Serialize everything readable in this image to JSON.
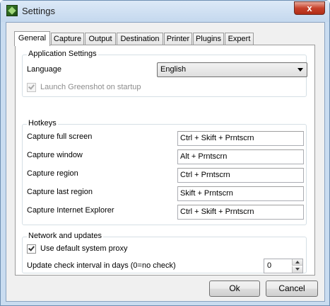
{
  "window": {
    "title": "Settings",
    "close_glyph": "x"
  },
  "tabs": [
    "General",
    "Capture",
    "Output",
    "Destination",
    "Printer",
    "Plugins",
    "Expert"
  ],
  "app_settings": {
    "title": "Application Settings",
    "language_label": "Language",
    "language_value": "English",
    "launch_label": "Launch Greenshot on startup",
    "launch_checked": true,
    "launch_enabled": false
  },
  "hotkeys": {
    "title": "Hotkeys",
    "items": [
      {
        "label": "Capture full screen",
        "value": "Ctrl + Skift + Prntscrn"
      },
      {
        "label": "Capture window",
        "value": "Alt + Prntscrn"
      },
      {
        "label": "Capture region",
        "value": "Ctrl + Prntscrn"
      },
      {
        "label": "Capture last region",
        "value": "Skift + Prntscrn"
      },
      {
        "label": "Capture Internet Explorer",
        "value": "Ctrl + Skift + Prntscrn"
      }
    ]
  },
  "network": {
    "title": "Network and updates",
    "proxy_label": "Use default system proxy",
    "proxy_checked": true,
    "interval_label": "Update check interval in days (0=no check)",
    "interval_value": "0"
  },
  "buttons": {
    "ok": "Ok",
    "cancel": "Cancel"
  }
}
